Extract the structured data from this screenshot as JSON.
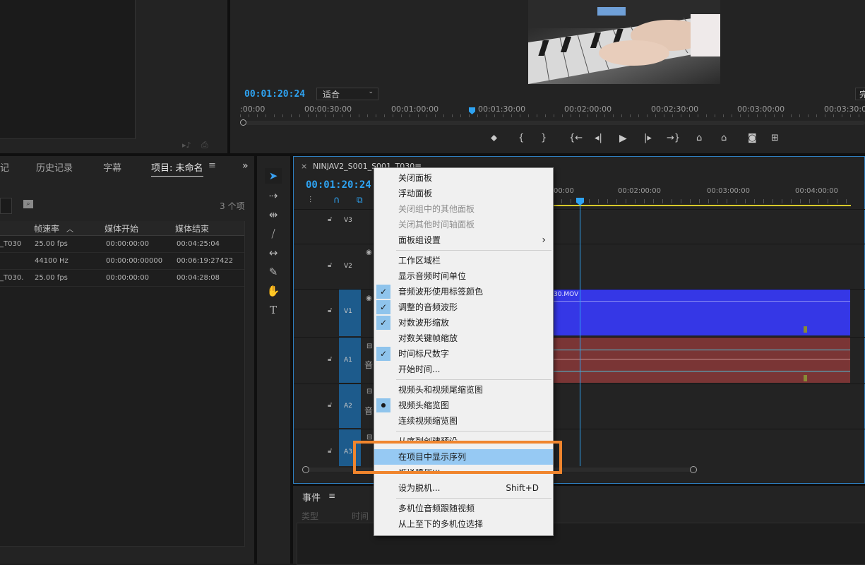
{
  "source": {
    "icons": [
      "audio-export-icon",
      "video-export-icon"
    ]
  },
  "program": {
    "timecode": "00:01:20:24",
    "fit_label": "适合",
    "right_edge_label": "完",
    "ruler_labels": [
      ":00:00",
      "00:00:30:00",
      "00:01:00:00",
      "00:01:30:00",
      "00:02:00:00",
      "00:02:30:00",
      "00:03:00:00",
      "00:03:30:00"
    ]
  },
  "transport": {
    "buttons": [
      "add-marker",
      "mark-in",
      "mark-out",
      "go-to-in",
      "step-back",
      "play",
      "step-forward",
      "go-to-out",
      "lift",
      "extract",
      "export-frame",
      "button-editor"
    ]
  },
  "project": {
    "tabs": [
      "记",
      "历史记录",
      "字幕",
      "项目: 未命名"
    ],
    "more": "»",
    "item_count": "3 个项",
    "columns": [
      "帧速率",
      "媒体开始",
      "媒体结束"
    ],
    "rows": [
      {
        "name": "_T030",
        "rate": "25.00 fps",
        "start": "00:00:00:00",
        "end": "00:04:25:04"
      },
      {
        "name": "",
        "rate": "44100 Hz",
        "start": "00:00:00:00000",
        "end": "00:06:19:27422"
      },
      {
        "name": "_T030.",
        "rate": "25.00 fps",
        "start": "00:00:00:00",
        "end": "00:04:28:08"
      }
    ]
  },
  "timeline": {
    "close": "×",
    "sequence_name": "NINJAV2_S001_S001_T030",
    "menu_icon": "≡",
    "timecode": "00:01:20:24",
    "ruler_labels": [
      "00:00",
      "00:02:00:00",
      "00:03:00:00",
      "00:04:00:00"
    ],
    "tracks": [
      "V3",
      "V2",
      "V1",
      "A1",
      "A2",
      "A3"
    ],
    "audio_glyph": "音",
    "clip_label": "30.MOV"
  },
  "events": {
    "title": "事件",
    "menu_icon": "≡",
    "columns": [
      "类型",
      "时间"
    ]
  },
  "context_menu": {
    "items": [
      {
        "label": "关闭面板",
        "state": "normal"
      },
      {
        "label": "浮动面板",
        "state": "normal"
      },
      {
        "label": "关闭组中的其他面板",
        "state": "disabled"
      },
      {
        "label": "关闭其他时间轴面板",
        "state": "disabled"
      },
      {
        "label": "面板组设置",
        "state": "submenu",
        "arrow": "›"
      },
      {
        "label": "工作区域栏",
        "state": "normal"
      },
      {
        "label": "显示音频时间单位",
        "state": "normal"
      },
      {
        "label": "音频波形使用标签颜色",
        "state": "checked"
      },
      {
        "label": "调整的音频波形",
        "state": "checked"
      },
      {
        "label": "对数波形缩放",
        "state": "checked"
      },
      {
        "label": "对数关键帧缩放",
        "state": "normal"
      },
      {
        "label": "时间标尺数字",
        "state": "checked"
      },
      {
        "label": "开始时间...",
        "state": "normal"
      },
      {
        "label": "视频头和视频尾缩览图",
        "state": "normal"
      },
      {
        "label": "视频头缩览图",
        "state": "radio"
      },
      {
        "label": "连续视频缩览图",
        "state": "normal"
      },
      {
        "label": "从序列创建预设",
        "state": "partial"
      },
      {
        "label": "在项目中显示序列",
        "state": "highlighted"
      },
      {
        "label": "链接媒体...",
        "state": "partial"
      },
      {
        "label": "设为脱机...",
        "state": "normal",
        "shortcut": "Shift+D"
      },
      {
        "label": "多机位音频跟随视频",
        "state": "normal"
      },
      {
        "label": "从上至下的多机位选择",
        "state": "normal"
      }
    ],
    "check_glyph": "✓",
    "radio_glyph": "●"
  },
  "colors": {
    "accent_blue": "#2ea3f2",
    "highlight_box": "#f0852d",
    "clip_video": "#3537e6",
    "clip_audio": "#7a3535",
    "track_blue": "#1d5b8c"
  }
}
